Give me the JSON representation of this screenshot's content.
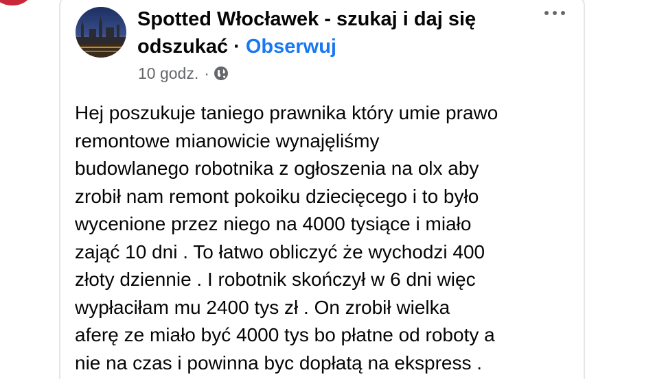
{
  "post": {
    "page_name": "Spotted Włocławek - szukaj i daj się odszukać",
    "separator": "·",
    "follow_label": "Obserwuj",
    "timestamp": "10 godz.",
    "meta_separator": "·",
    "privacy_icon": "globe-icon",
    "more_icon": "more-options-icon",
    "body": "Hej poszukuje taniego prawnika który umie prawo\nremontowe mianowicie wynajęliśmy\nbudowlanego robotnika z ogłoszenia na olx aby\nzrobił nam remont pokoiku dziecięcego i to było\nwycenione przez niego na 4000 tysiące i miało\nzająć 10 dni . To łatwo obliczyć że wychodzi 400\nzłoty dziennie . I robotnik skończył w 6 dni więc\nwypłaciłam  mu 2400 tys zł . On zrobił wielka\naferę ze miało być 4000 tys bo płatne od roboty a\nnie na czas i powinna byc dopłatą na ekspress ."
  },
  "colors": {
    "accent": "#1877f2",
    "text": "#050505",
    "secondary_text": "#65676b",
    "card_border": "#e3e5e8"
  }
}
